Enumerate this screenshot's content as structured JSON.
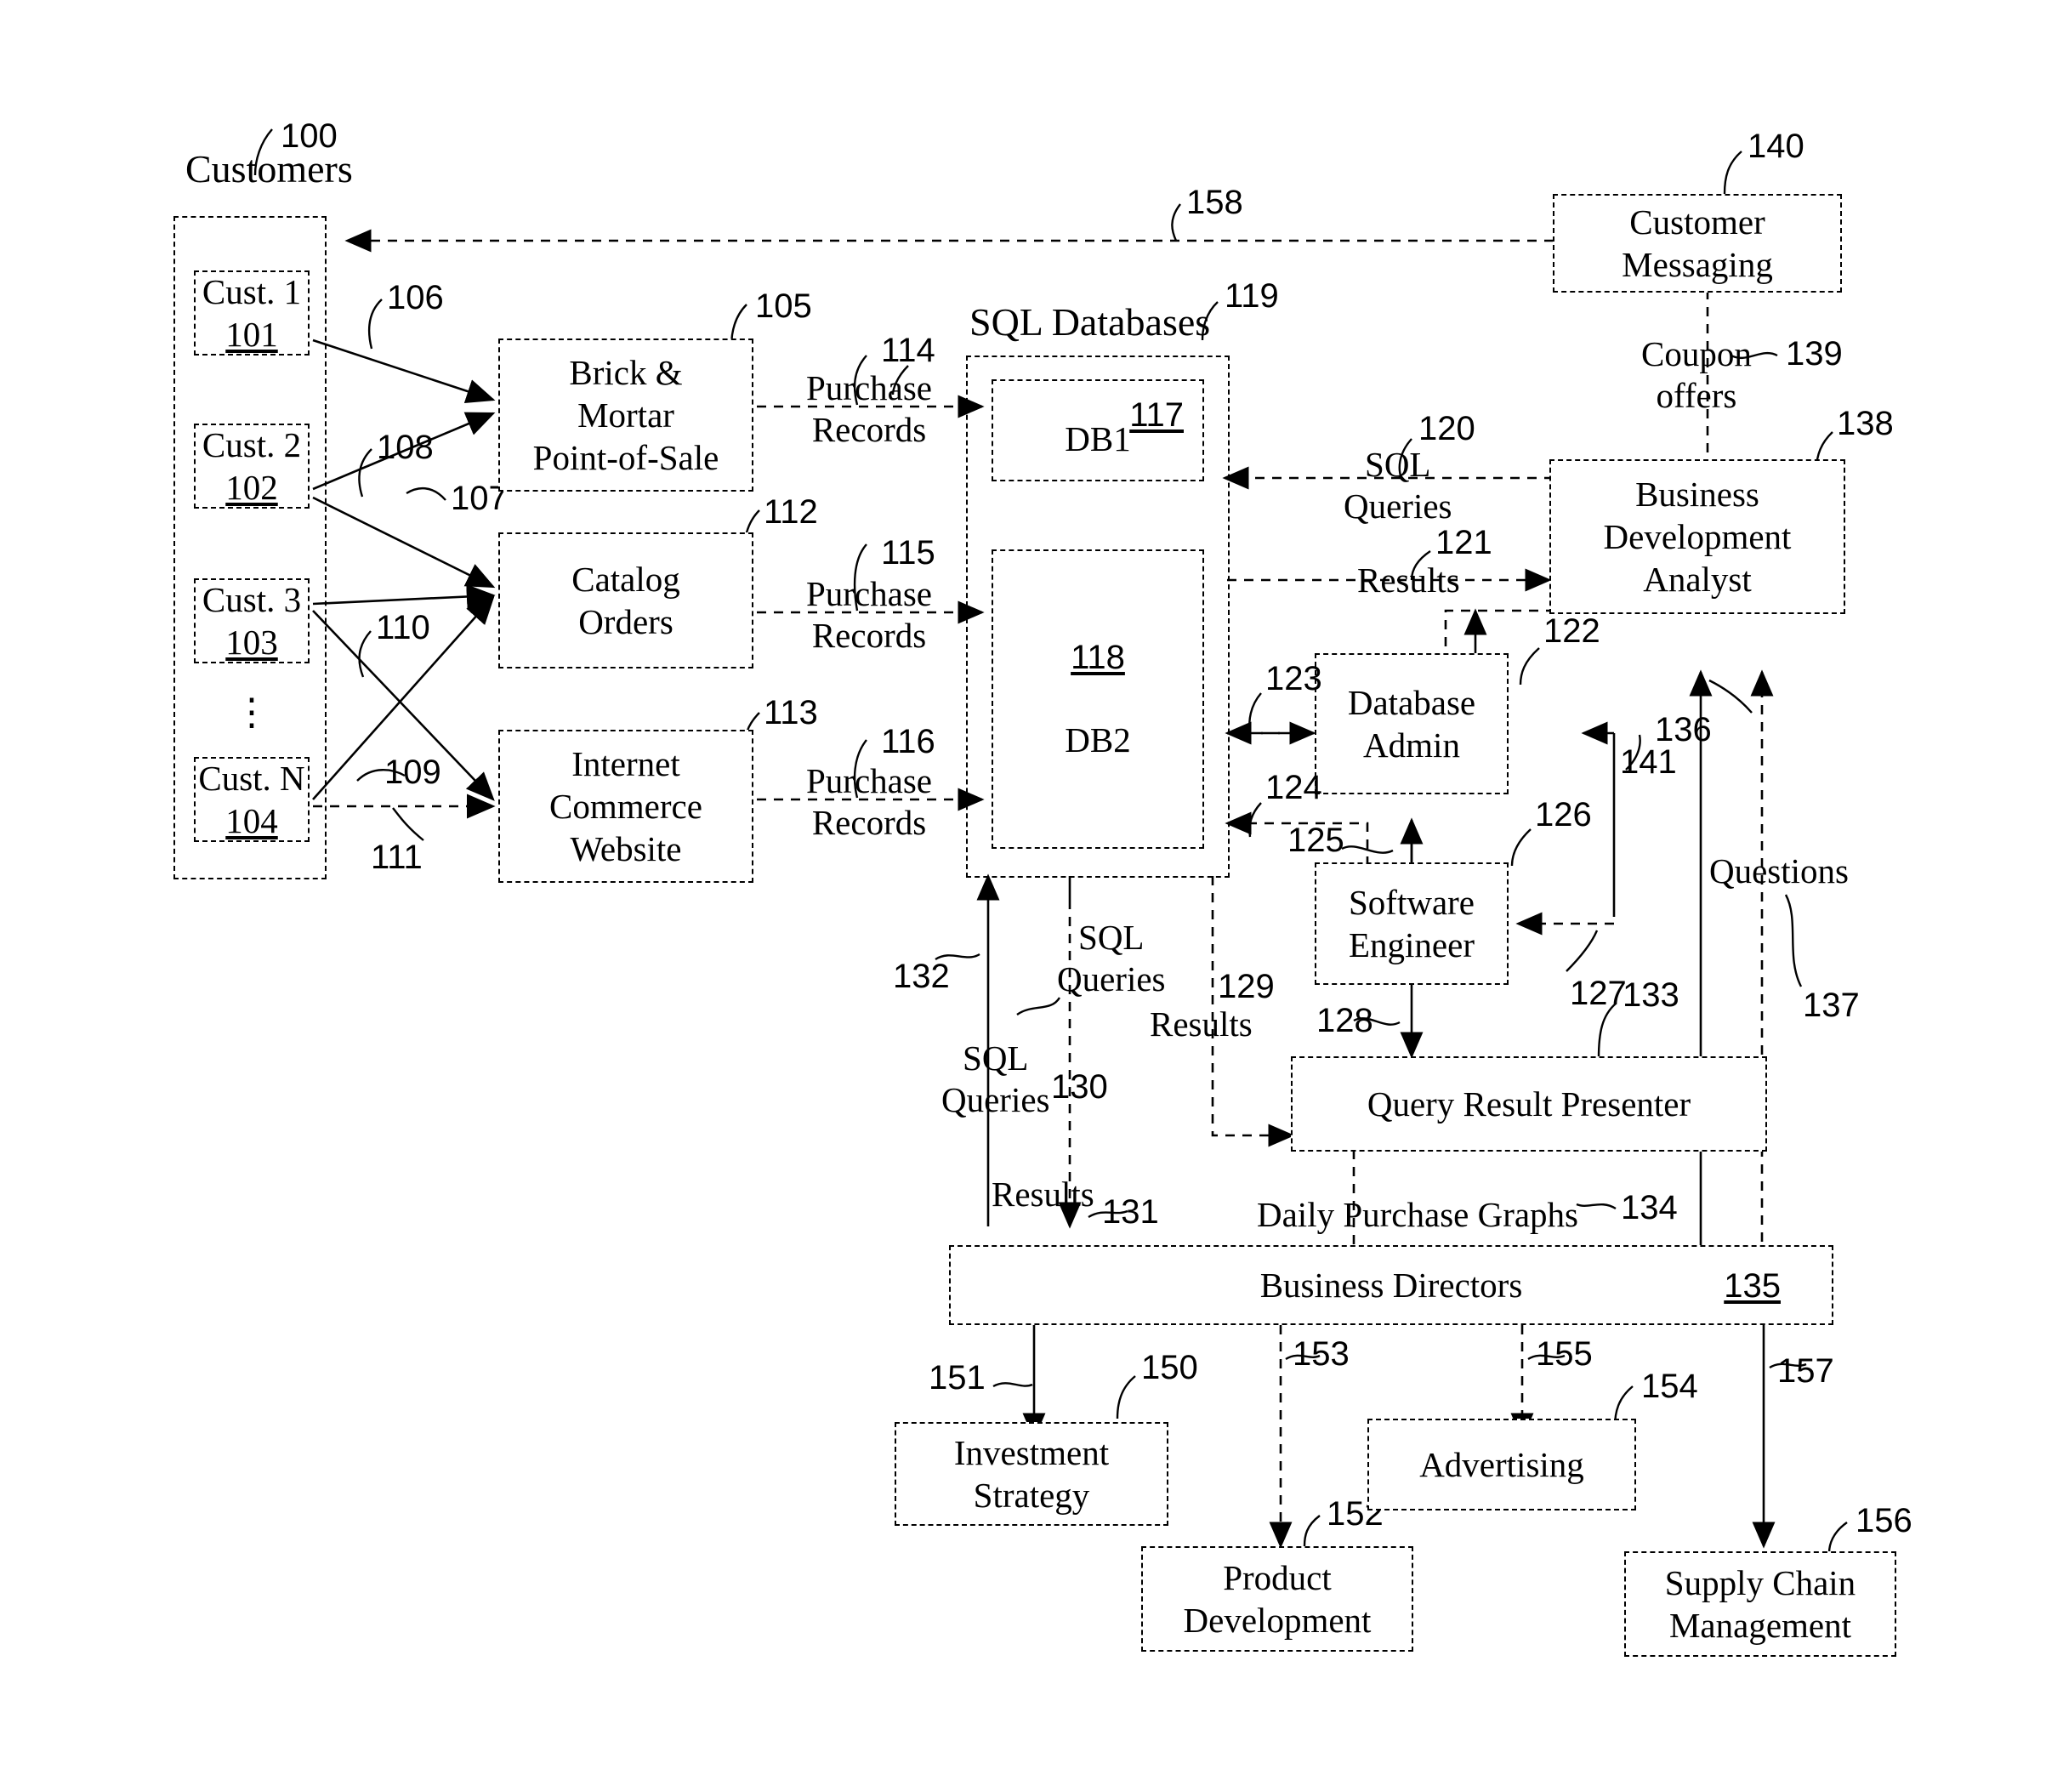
{
  "figure": {
    "title_group_customers": "Customers",
    "title_group_databases": "SQL Databases"
  },
  "customers": {
    "group_ref": "100",
    "items": [
      {
        "label": "Cust. 1",
        "ref": "101"
      },
      {
        "label": "Cust. 2",
        "ref": "102"
      },
      {
        "label": "Cust. 3",
        "ref": "103"
      },
      {
        "label": "Cust. N",
        "ref": "104"
      }
    ],
    "ellipsis": "⋮"
  },
  "channels": [
    {
      "label": "Brick &\nMortar\nPoint-of-Sale",
      "ref": "105"
    },
    {
      "label": "Catalog\nOrders",
      "ref": "112"
    },
    {
      "label": "Internet\nCommerce\nWebsite",
      "ref": "113"
    }
  ],
  "customer_channel_links": [
    {
      "ref": "106"
    },
    {
      "ref": "107"
    },
    {
      "ref": "108"
    },
    {
      "ref": "109"
    },
    {
      "ref": "110"
    },
    {
      "ref": "111"
    }
  ],
  "purchase_record_flows": [
    {
      "label": "Purchase\nRecords",
      "ref": "114"
    },
    {
      "label": "Purchase\nRecords",
      "ref": "115"
    },
    {
      "label": "Purchase\nRecords",
      "ref": "116"
    }
  ],
  "databases": {
    "group_ref": "119",
    "items": [
      {
        "label": "DB1",
        "ref": "117"
      },
      {
        "label": "DB2",
        "ref": "118"
      }
    ]
  },
  "actors": [
    {
      "label": "Business\nDevelopment\nAnalyst",
      "ref": "138"
    },
    {
      "label": "Database\nAdmin",
      "ref": "122"
    },
    {
      "label": "Software\nEngineer",
      "ref": "126"
    },
    {
      "label": "Query Result Presenter",
      "ref": "133"
    },
    {
      "label": "Business Directors",
      "ref": "135"
    },
    {
      "label": "Customer\nMessaging",
      "ref": "140"
    }
  ],
  "flows": [
    {
      "label": "SQL\nQueries",
      "ref": "120"
    },
    {
      "label": "Results",
      "ref": "121"
    },
    {
      "label": "",
      "ref": "123"
    },
    {
      "label": "",
      "ref": "124"
    },
    {
      "label": "",
      "ref": "125"
    },
    {
      "label": "",
      "ref": "127"
    },
    {
      "label": "",
      "ref": "128"
    },
    {
      "label": "Results",
      "ref": "129"
    },
    {
      "label": "SQL\nQueries",
      "ref": "130"
    },
    {
      "label": "Results",
      "ref": "131"
    },
    {
      "label": "SQL\nQueries",
      "ref": "132"
    },
    {
      "label": "Daily Purchase Graphs",
      "ref": "134"
    },
    {
      "label": "",
      "ref": "136"
    },
    {
      "label": "Questions",
      "ref": "137"
    },
    {
      "label": "Coupon\noffers",
      "ref": "139"
    },
    {
      "label": "",
      "ref": "141"
    },
    {
      "label": "",
      "ref": "158"
    }
  ],
  "outcomes": [
    {
      "label": "Investment\nStrategy",
      "ref": "150",
      "arrow_ref": "151"
    },
    {
      "label": "Product\nDevelopment",
      "ref": "152",
      "arrow_ref": "153"
    },
    {
      "label": "Advertising",
      "ref": "154",
      "arrow_ref": "155"
    },
    {
      "label": "Supply Chain\nManagement",
      "ref": "156",
      "arrow_ref": "157"
    }
  ],
  "refs": {
    "r100": "100",
    "r101": "101",
    "r102": "102",
    "r103": "103",
    "r104": "104",
    "r105": "105",
    "r106": "106",
    "r107": "107",
    "r108": "108",
    "r109": "109",
    "r110": "110",
    "r111": "111",
    "r112": "112",
    "r113": "113",
    "r114": "114",
    "r115": "115",
    "r116": "116",
    "r117": "117",
    "r118": "118",
    "r119": "119",
    "r120": "120",
    "r121": "121",
    "r122": "122",
    "r123": "123",
    "r124": "124",
    "r125": "125",
    "r126": "126",
    "r127": "127",
    "r128": "128",
    "r129": "129",
    "r130": "130",
    "r131": "131",
    "r132": "132",
    "r133": "133",
    "r134": "134",
    "r135": "135",
    "r136": "136",
    "r137": "137",
    "r138": "138",
    "r139": "139",
    "r140": "140",
    "r141": "141",
    "r150": "150",
    "r151": "151",
    "r152": "152",
    "r153": "153",
    "r154": "154",
    "r155": "155",
    "r156": "156",
    "r157": "157",
    "r158": "158"
  },
  "texts": {
    "customers": "Customers",
    "sql_databases": "SQL Databases",
    "cust1": "Cust. 1",
    "cust2": "Cust. 2",
    "cust3": "Cust. 3",
    "custN": "Cust. N",
    "brick": "Brick &\nMortar\nPoint-of-Sale",
    "catalog": "Catalog\nOrders",
    "internet": "Internet\nCommerce\nWebsite",
    "purchase_records": "Purchase\nRecords",
    "db1": "DB1",
    "db2": "DB2",
    "sql_queries": "SQL\nQueries",
    "results": "Results",
    "bda": "Business\nDevelopment\nAnalyst",
    "dbadmin": "Database\nAdmin",
    "swe": "Software\nEngineer",
    "qrp": "Query Result Presenter",
    "bizdir": "Business Directors",
    "custmsg": "Customer\nMessaging",
    "coupon": "Coupon\noffers",
    "questions": "Questions",
    "daily_graphs": "Daily Purchase Graphs",
    "investment": "Investment\nStrategy",
    "proddev": "Product\nDevelopment",
    "advertising": "Advertising",
    "supplychain": "Supply Chain\nManagement",
    "ellipsis": "⋮"
  },
  "colors": {
    "ink": "#000000",
    "paper": "#ffffff"
  }
}
